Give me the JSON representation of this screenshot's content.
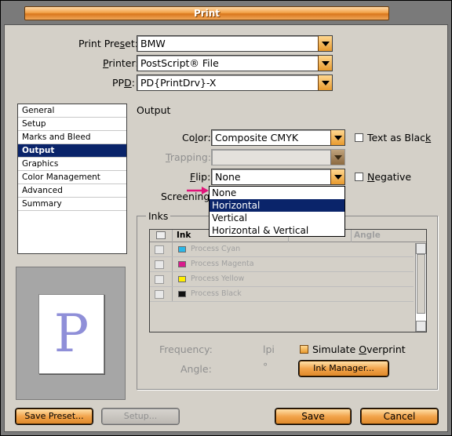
{
  "window": {
    "title": "Print"
  },
  "print_preset": {
    "label_pre": "Print Pre",
    "label_u": "s",
    "label_post": "et:",
    "value": "BMW"
  },
  "printer": {
    "label_u": "P",
    "label_post": "rinter:",
    "value": "PostScript® File"
  },
  "ppd": {
    "label_pre": "PP",
    "label_u": "D",
    "label_post": ":",
    "value": "PD{PrintDrv}-X"
  },
  "categories": [
    "General",
    "Setup",
    "Marks and Bleed",
    "Output",
    "Graphics",
    "Color Management",
    "Advanced",
    "Summary"
  ],
  "selected_category": "Output",
  "preview": {
    "letter": "P"
  },
  "section_title": "Output",
  "color": {
    "label_pre": "Co",
    "label_u": "l",
    "label_post": "or:",
    "value": "Composite CMYK"
  },
  "text_as_black": {
    "label_pre": "Text as Blac",
    "label_u": "k",
    "checked": false
  },
  "trapping": {
    "label_pre": "",
    "label_u": "T",
    "label_post": "rapping:",
    "value": ""
  },
  "flip": {
    "label_u": "F",
    "label_post": "lip:",
    "value": "None",
    "options": [
      "None",
      "Horizontal",
      "Vertical",
      "Horizontal & Vertical"
    ],
    "highlighted": "Horizontal"
  },
  "negative": {
    "label_u": "N",
    "label_post": "egative",
    "checked": false
  },
  "screening": {
    "label": "Screening:"
  },
  "inks": {
    "title": "Inks",
    "headers": {
      "ink": "Ink",
      "angle": "Angle"
    },
    "rows": [
      {
        "name": "Process Cyan",
        "color": "#2bb7e8"
      },
      {
        "name": "Process Magenta",
        "color": "#d81b8c"
      },
      {
        "name": "Process Yellow",
        "color": "#ffee00"
      },
      {
        "name": "Process Black",
        "color": "#111111"
      }
    ]
  },
  "frequency": {
    "label": "Frequency:",
    "unit": "lpi"
  },
  "angle": {
    "label": "Angle:",
    "unit": "°"
  },
  "simulate_overprint": {
    "label_pre": "Simulate ",
    "label_u": "O",
    "label_post": "verprint"
  },
  "ink_manager": {
    "label": "Ink Manager..."
  },
  "buttons": {
    "save_preset": "Save Preset...",
    "setup": "Setup...",
    "save": "Save",
    "cancel": "Cancel"
  },
  "colors": {
    "accent": "#f2a24a",
    "selection": "#0a246a",
    "annotation_arrow": "#e0147a"
  }
}
